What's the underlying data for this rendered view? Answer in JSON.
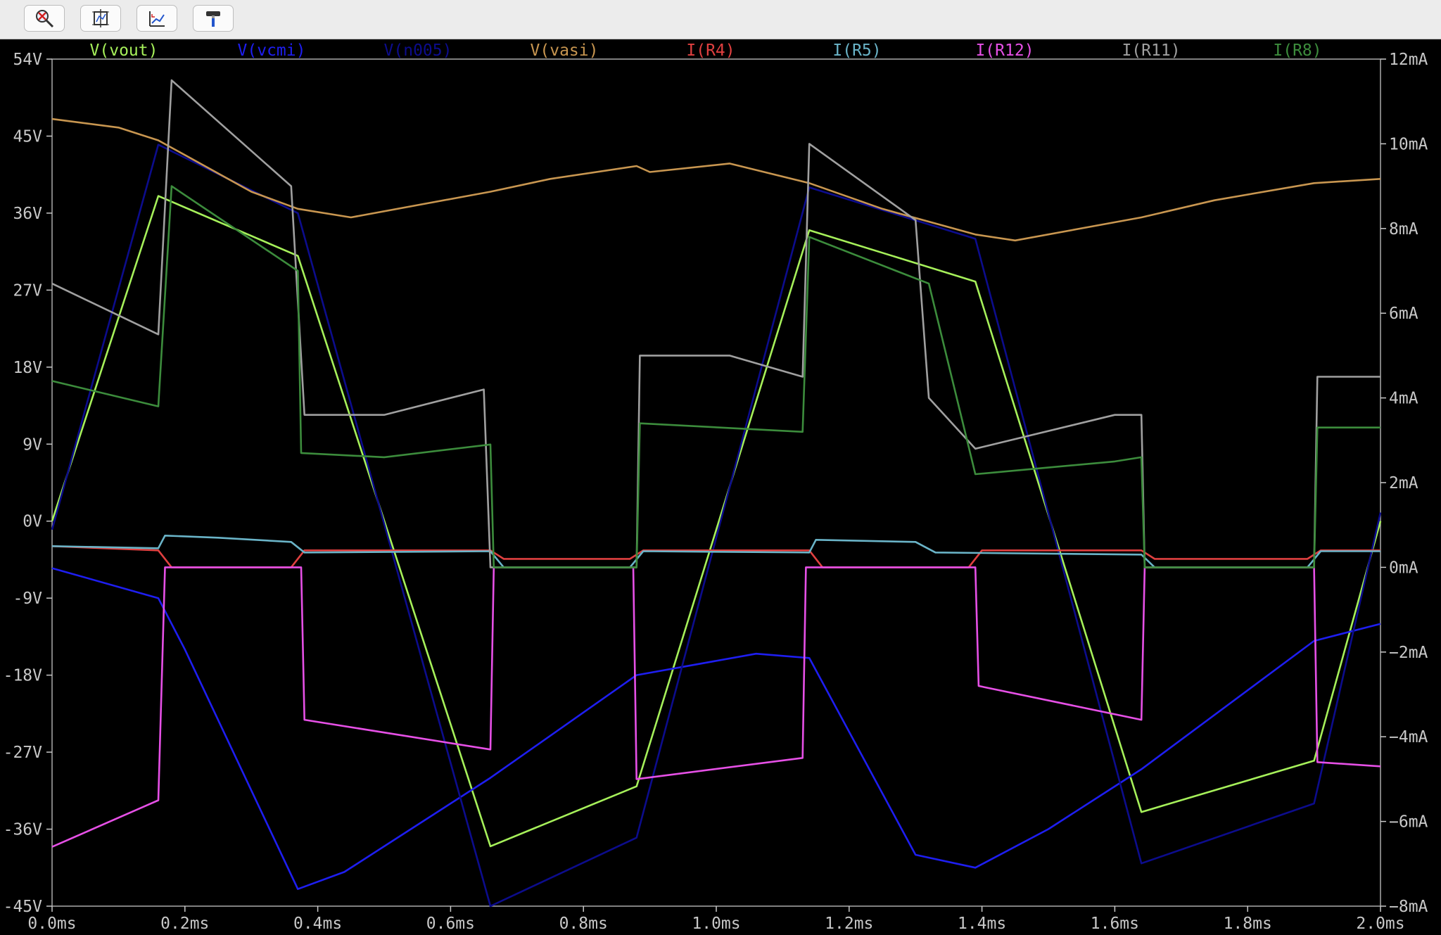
{
  "toolbar": {
    "buttons": [
      {
        "icon": "zoom-cancel-icon"
      },
      {
        "icon": "autorange-icon"
      },
      {
        "icon": "pan-zoom-icon"
      },
      {
        "icon": "hammer-icon"
      }
    ]
  },
  "colors": {
    "background": "#000000",
    "grid_frame": "#aaaaaa",
    "tick_labels": "#c8c8c8"
  },
  "chart_data": {
    "type": "line",
    "x_axis": {
      "range": [
        0,
        2.0
      ],
      "unit": "ms",
      "ticks": [
        "0.0ms",
        "0.2ms",
        "0.4ms",
        "0.6ms",
        "0.8ms",
        "1.0ms",
        "1.2ms",
        "1.4ms",
        "1.6ms",
        "1.8ms",
        "2.0ms"
      ]
    },
    "y_left": {
      "range": [
        -45,
        54
      ],
      "unit": "V",
      "ticks": [
        "54V",
        "45V",
        "36V",
        "27V",
        "18V",
        "9V",
        "0V",
        "-9V",
        "-18V",
        "-27V",
        "-36V",
        "-45V"
      ]
    },
    "y_right": {
      "range": [
        -8,
        12
      ],
      "unit": "mA",
      "ticks": [
        "12mA",
        "10mA",
        "8mA",
        "6mA",
        "4mA",
        "2mA",
        "0mA",
        "−2mA",
        "−4mA",
        "−6mA",
        "−8mA"
      ]
    },
    "grid": false,
    "legend_position": "top",
    "series": [
      {
        "name": "V(vout)",
        "axis": "left",
        "color": "#a6f05a",
        "points": [
          [
            0,
            0
          ],
          [
            0.16,
            38
          ],
          [
            0.37,
            31
          ],
          [
            0.66,
            -38
          ],
          [
            0.88,
            -31
          ],
          [
            1.14,
            34
          ],
          [
            1.39,
            28
          ],
          [
            1.64,
            -34
          ],
          [
            1.9,
            -28
          ],
          [
            2.0,
            0
          ]
        ]
      },
      {
        "name": "V(vcmi)",
        "axis": "left",
        "color": "#1e1ef0",
        "points": [
          [
            0,
            -5.5
          ],
          [
            0.16,
            -9
          ],
          [
            0.2,
            -15
          ],
          [
            0.37,
            -43
          ],
          [
            0.44,
            -41
          ],
          [
            0.66,
            -30
          ],
          [
            0.88,
            -18
          ],
          [
            1.06,
            -15.5
          ],
          [
            1.14,
            -16
          ],
          [
            1.3,
            -39
          ],
          [
            1.39,
            -40.5
          ],
          [
            1.5,
            -36
          ],
          [
            1.64,
            -29
          ],
          [
            1.9,
            -14
          ],
          [
            2.0,
            -12
          ]
        ]
      },
      {
        "name": "V(n005)",
        "axis": "left",
        "color": "#0c0c8c",
        "points": [
          [
            0,
            -1
          ],
          [
            0.16,
            44
          ],
          [
            0.37,
            36
          ],
          [
            0.66,
            -45
          ],
          [
            0.88,
            -37
          ],
          [
            1.14,
            39
          ],
          [
            1.39,
            33
          ],
          [
            1.64,
            -40
          ],
          [
            1.9,
            -33
          ],
          [
            2.0,
            1
          ]
        ]
      },
      {
        "name": "V(vasi)",
        "axis": "left",
        "color": "#c89650",
        "points": [
          [
            0,
            47
          ],
          [
            0.1,
            46
          ],
          [
            0.16,
            44.5
          ],
          [
            0.3,
            38.5
          ],
          [
            0.37,
            36.5
          ],
          [
            0.45,
            35.5
          ],
          [
            0.66,
            38.5
          ],
          [
            0.75,
            40
          ],
          [
            0.88,
            41.5
          ],
          [
            0.9,
            40.8
          ],
          [
            1.02,
            41.8
          ],
          [
            1.14,
            39.5
          ],
          [
            1.25,
            36.5
          ],
          [
            1.39,
            33.5
          ],
          [
            1.45,
            32.8
          ],
          [
            1.64,
            35.5
          ],
          [
            1.75,
            37.5
          ],
          [
            1.9,
            39.5
          ],
          [
            2.0,
            40
          ]
        ]
      },
      {
        "name": "I(R4)",
        "axis": "right",
        "color": "#e04040",
        "points": [
          [
            0,
            0.5
          ],
          [
            0.16,
            0.4
          ],
          [
            0.18,
            0
          ],
          [
            0.36,
            0
          ],
          [
            0.38,
            0.4
          ],
          [
            0.66,
            0.4
          ],
          [
            0.68,
            0.2
          ],
          [
            0.87,
            0.2
          ],
          [
            0.89,
            0.4
          ],
          [
            1.14,
            0.4
          ],
          [
            1.16,
            0
          ],
          [
            1.38,
            0
          ],
          [
            1.4,
            0.4
          ],
          [
            1.64,
            0.4
          ],
          [
            1.66,
            0.2
          ],
          [
            1.89,
            0.2
          ],
          [
            1.91,
            0.4
          ],
          [
            2.0,
            0.4
          ]
        ]
      },
      {
        "name": "I(R5)",
        "axis": "right",
        "color": "#6ab4c8",
        "points": [
          [
            0,
            0.5
          ],
          [
            0.16,
            0.45
          ],
          [
            0.17,
            0.75
          ],
          [
            0.25,
            0.7
          ],
          [
            0.36,
            0.6
          ],
          [
            0.38,
            0.35
          ],
          [
            0.66,
            0.38
          ],
          [
            0.68,
            0
          ],
          [
            0.87,
            0
          ],
          [
            0.89,
            0.38
          ],
          [
            1.14,
            0.35
          ],
          [
            1.15,
            0.65
          ],
          [
            1.3,
            0.6
          ],
          [
            1.33,
            0.35
          ],
          [
            1.64,
            0.3
          ],
          [
            1.66,
            0
          ],
          [
            1.89,
            0
          ],
          [
            1.91,
            0.38
          ],
          [
            2.0,
            0.38
          ]
        ]
      },
      {
        "name": "I(R12)",
        "axis": "right",
        "color": "#e650e6",
        "points": [
          [
            0,
            -6.6
          ],
          [
            0.16,
            -5.5
          ],
          [
            0.17,
            0
          ],
          [
            0.375,
            0
          ],
          [
            0.38,
            -3.6
          ],
          [
            0.66,
            -4.3
          ],
          [
            0.665,
            0
          ],
          [
            0.875,
            0
          ],
          [
            0.88,
            -5
          ],
          [
            1.13,
            -4.5
          ],
          [
            1.135,
            0
          ],
          [
            1.39,
            0
          ],
          [
            1.395,
            -2.8
          ],
          [
            1.64,
            -3.6
          ],
          [
            1.645,
            0
          ],
          [
            1.9,
            0
          ],
          [
            1.905,
            -4.6
          ],
          [
            2.0,
            -4.7
          ]
        ]
      },
      {
        "name": "I(R11)",
        "axis": "right",
        "color": "#a0a0a0",
        "points": [
          [
            0,
            6.7
          ],
          [
            0.16,
            5.5
          ],
          [
            0.18,
            11.5
          ],
          [
            0.36,
            9
          ],
          [
            0.38,
            3.6
          ],
          [
            0.5,
            3.6
          ],
          [
            0.65,
            4.2
          ],
          [
            0.66,
            0
          ],
          [
            0.88,
            0
          ],
          [
            0.885,
            5
          ],
          [
            1.02,
            5
          ],
          [
            1.13,
            4.5
          ],
          [
            1.14,
            10
          ],
          [
            1.3,
            8.2
          ],
          [
            1.32,
            4
          ],
          [
            1.39,
            2.8
          ],
          [
            1.6,
            3.6
          ],
          [
            1.64,
            3.6
          ],
          [
            1.645,
            0
          ],
          [
            1.9,
            0
          ],
          [
            1.905,
            4.5
          ],
          [
            2.0,
            4.5
          ]
        ]
      },
      {
        "name": "I(R8)",
        "axis": "right",
        "color": "#3c8c3c",
        "points": [
          [
            0,
            4.4
          ],
          [
            0.16,
            3.8
          ],
          [
            0.18,
            9
          ],
          [
            0.37,
            7
          ],
          [
            0.375,
            2.7
          ],
          [
            0.5,
            2.6
          ],
          [
            0.66,
            2.9
          ],
          [
            0.665,
            0
          ],
          [
            0.88,
            0
          ],
          [
            0.885,
            3.4
          ],
          [
            1.13,
            3.2
          ],
          [
            1.14,
            7.8
          ],
          [
            1.32,
            6.7
          ],
          [
            1.39,
            2.2
          ],
          [
            1.6,
            2.5
          ],
          [
            1.64,
            2.6
          ],
          [
            1.645,
            0
          ],
          [
            1.9,
            0
          ],
          [
            1.905,
            3.3
          ],
          [
            2.0,
            3.3
          ]
        ]
      }
    ]
  }
}
